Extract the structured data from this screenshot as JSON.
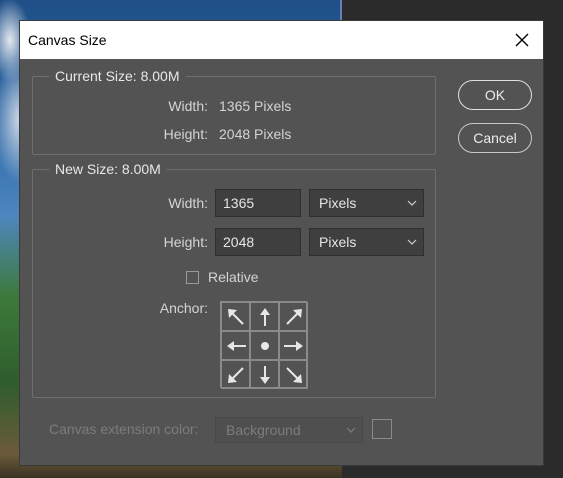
{
  "dialog": {
    "title": "Canvas Size",
    "ok_label": "OK",
    "cancel_label": "Cancel"
  },
  "current_size": {
    "legend": "Current Size: 8.00M",
    "width_label": "Width:",
    "width_value": "1365 Pixels",
    "height_label": "Height:",
    "height_value": "2048 Pixels"
  },
  "new_size": {
    "legend": "New Size: 8.00M",
    "width_label": "Width:",
    "width_value": "1365",
    "width_unit": "Pixels",
    "height_label": "Height:",
    "height_value": "2048",
    "height_unit": "Pixels",
    "relative_label": "Relative",
    "relative_checked": false,
    "anchor_label": "Anchor:",
    "anchor_cells": [
      "arrow-up-left-icon",
      "arrow-up-icon",
      "arrow-up-right-icon",
      "arrow-left-icon",
      "anchor-dot-icon",
      "arrow-right-icon",
      "arrow-down-left-icon",
      "arrow-down-icon",
      "arrow-down-right-icon"
    ]
  },
  "extension": {
    "label": "Canvas extension color:",
    "value": "Background"
  },
  "colors": {
    "dialog_bg": "#535353",
    "titlebar_bg": "#ffffff",
    "input_bg": "#3f3f3f",
    "text": "#d4d4d4",
    "disabled_text": "#7c7c7c"
  }
}
